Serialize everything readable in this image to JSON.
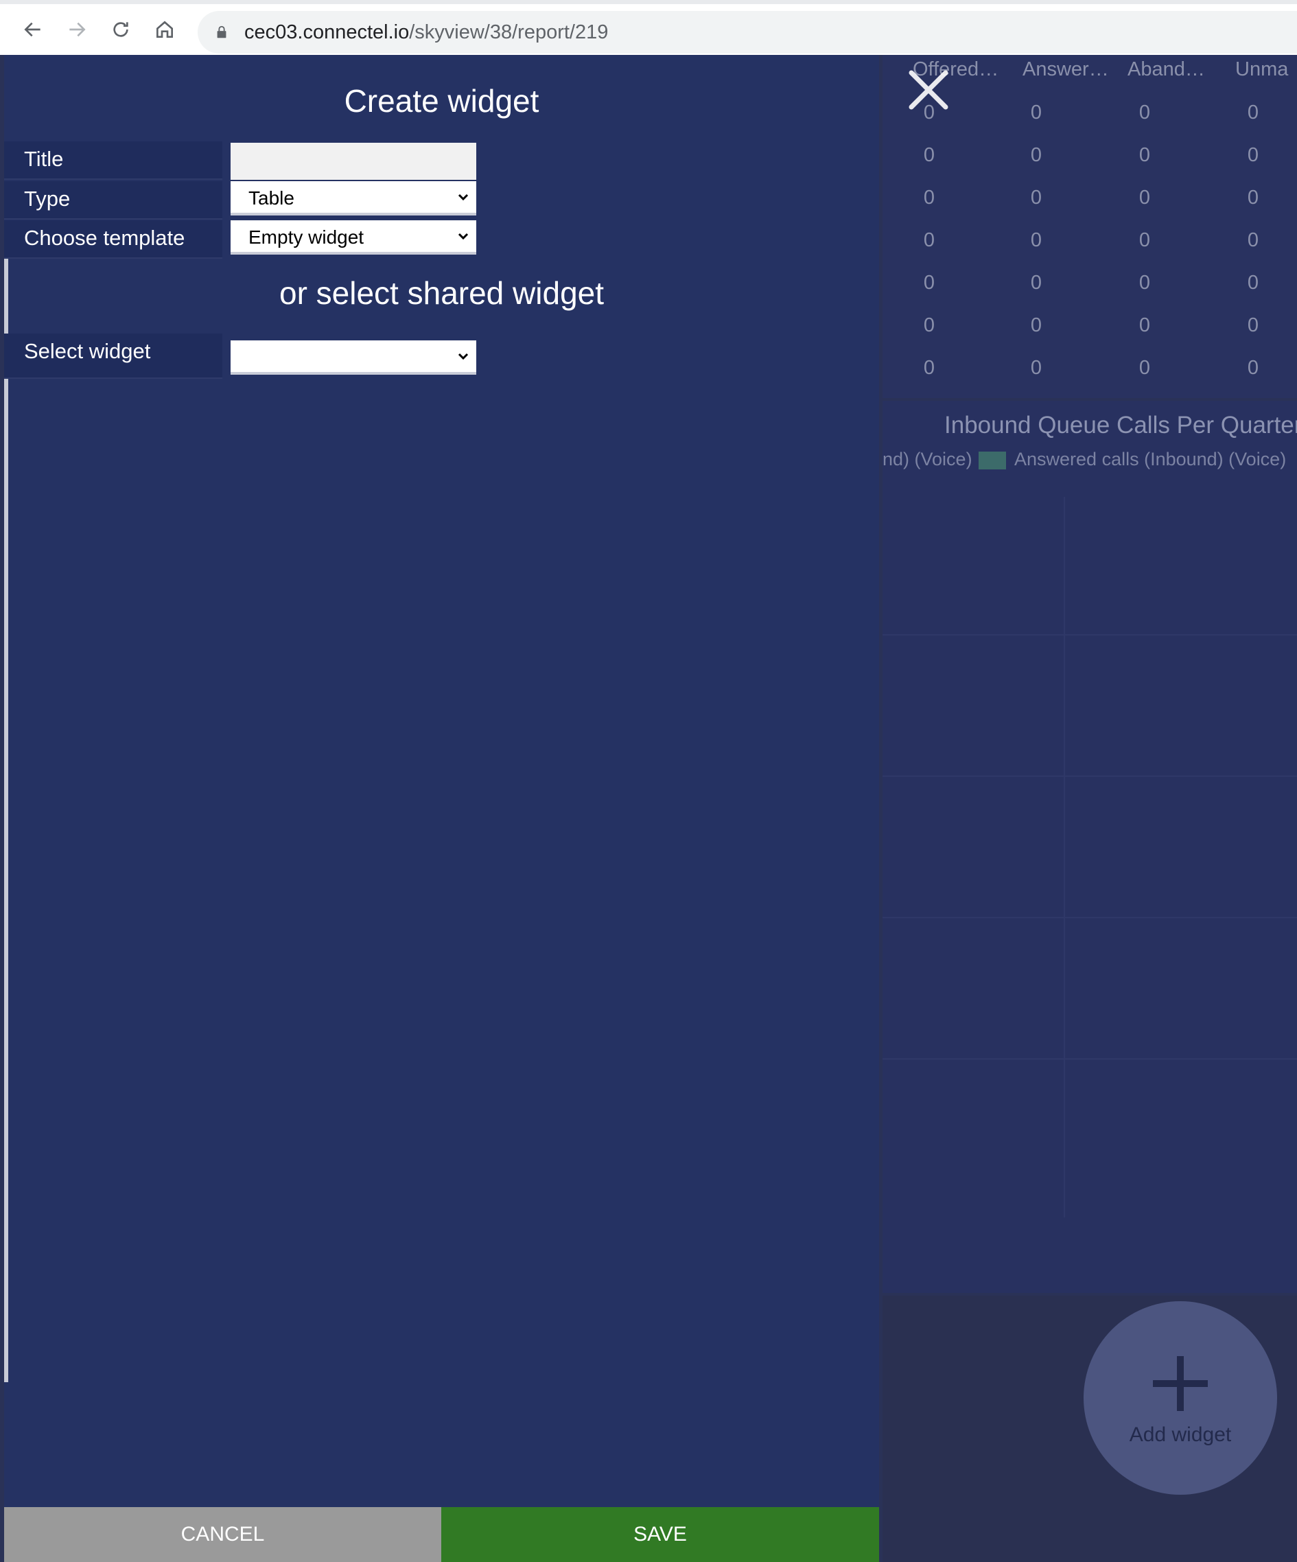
{
  "browser": {
    "url_host": "cec03.connectel.io",
    "url_path": "/skyview/38/report/219"
  },
  "modal": {
    "title": "Create widget",
    "fields": [
      {
        "label": "Title",
        "value": ""
      },
      {
        "label": "Type",
        "value": "Table"
      },
      {
        "label": "Choose template",
        "value": "Empty widget"
      }
    ],
    "shared_subtitle": "or select shared widget",
    "select_widget_label": "Select widget",
    "select_widget_value": "",
    "cancel_label": "CANCEL",
    "save_label": "SAVE"
  },
  "dashboard": {
    "table_headers": [
      "Offered…",
      "Answer…",
      "Aband…",
      "Unma"
    ],
    "table_rows": [
      [
        "0",
        "0",
        "0",
        "0"
      ],
      [
        "0",
        "0",
        "0",
        "0"
      ],
      [
        "0",
        "0",
        "0",
        "0"
      ],
      [
        "0",
        "0",
        "0",
        "0"
      ],
      [
        "0",
        "0",
        "0",
        "0"
      ],
      [
        "0",
        "0",
        "0",
        "0"
      ],
      [
        "0",
        "0",
        "0",
        "0"
      ]
    ],
    "chart_title": "Inbound Queue Calls Per Quarter H",
    "legend_item_1": "nd) (Voice)",
    "legend_item_2": "Answered calls (Inbound) (Voice)",
    "add_widget_label": "Add widget"
  },
  "colors": {
    "panel": "#253263",
    "save": "#317a24",
    "cancel": "#9a9a9a",
    "legend_swatch": "#3c6b6a"
  }
}
